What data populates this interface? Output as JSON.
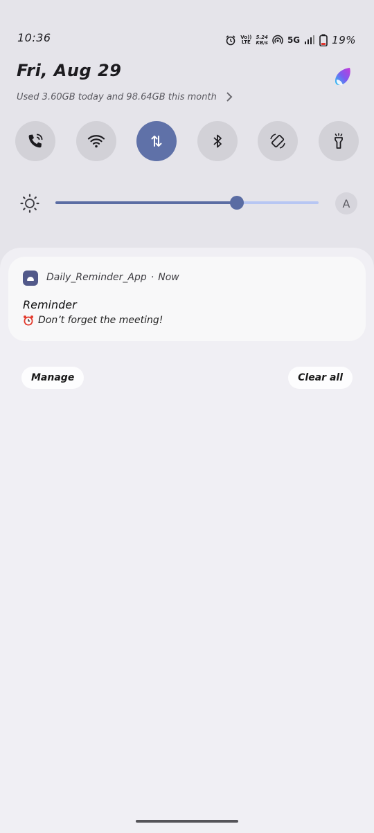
{
  "status_bar": {
    "time": "10:36",
    "volte_top": "Vo))",
    "volte_bottom": "LTE",
    "speed_value": "5.24",
    "speed_unit": "KB/s",
    "network": "5G",
    "battery_percent": "19%",
    "icons": [
      "alarm-icon",
      "volte-icon",
      "hotspot-icon",
      "signal-icon",
      "battery-icon"
    ]
  },
  "header": {
    "date": "Fri, Aug 29",
    "data_usage": "Used 3.60GB today and 98.64GB this month"
  },
  "quick_settings": [
    {
      "name": "calls",
      "icon": "phone-wifi-icon",
      "active": false
    },
    {
      "name": "wifi",
      "icon": "wifi-icon",
      "active": false
    },
    {
      "name": "mobile-data",
      "icon": "data-arrows-icon",
      "active": true
    },
    {
      "name": "bluetooth",
      "icon": "bluetooth-icon",
      "active": false
    },
    {
      "name": "auto-rotate",
      "icon": "rotate-icon",
      "active": false
    },
    {
      "name": "flashlight",
      "icon": "flashlight-icon",
      "active": false
    }
  ],
  "brightness": {
    "level": 0.69,
    "auto_label": "A"
  },
  "notification": {
    "app_name": "Daily_Reminder_App",
    "separator": "·",
    "time": "Now",
    "title": "Reminder",
    "text": "Don’t forget the meeting!"
  },
  "actions": {
    "manage_label": "Manage",
    "clear_label": "Clear all"
  },
  "colors": {
    "accent": "#5f71a8",
    "background": "#e5e4ea",
    "shade": "#f0eff4",
    "tile": "#d2d1d7"
  }
}
